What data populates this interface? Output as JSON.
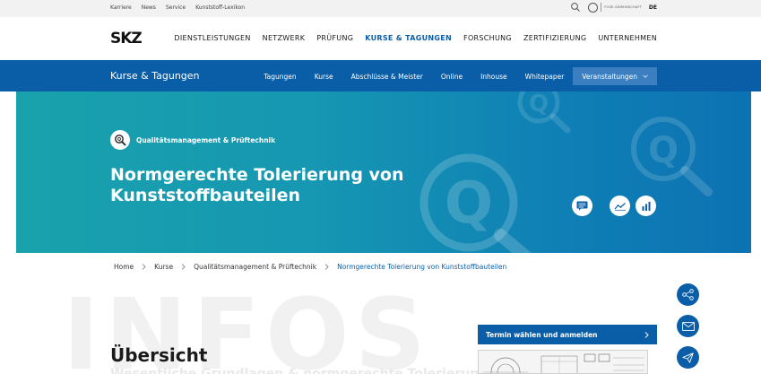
{
  "utility": {
    "links": [
      "Karriere",
      "News",
      "Service",
      "Kunststoff-Lexikon"
    ],
    "group_label": "FOSE-GEMEINSCHAFT",
    "language": "DE"
  },
  "header": {
    "brand": "SKZ",
    "nav": [
      {
        "label": "DIENSTLEISTUNGEN",
        "active": false
      },
      {
        "label": "NETZWERK",
        "active": false
      },
      {
        "label": "PRÜFUNG",
        "active": false
      },
      {
        "label": "KURSE & TAGUNGEN",
        "active": true
      },
      {
        "label": "FORSCHUNG",
        "active": false
      },
      {
        "label": "ZERTIFIZIERUNG",
        "active": false
      },
      {
        "label": "UNTERNEHMEN",
        "active": false
      }
    ]
  },
  "subnav": {
    "title": "Kurse & Tagungen",
    "items": [
      "Tagungen",
      "Kurse",
      "Abschlüsse & Meister",
      "Online",
      "Inhouse",
      "Whitepaper"
    ],
    "dropdown_label": "Veranstaltungen"
  },
  "hero": {
    "category": "Qualitätsmanagement & Prüftechnik",
    "title": "Normgerechte Tolerierung von Kunststoffbauteilen"
  },
  "breadcrumb": [
    "Home",
    "Kurse",
    "Qualitätsmanagement & Prüftechnik",
    "Normgerechte Tolerierung von Kunststoffbauteilen"
  ],
  "content": {
    "background_word": "INFOS",
    "section_title": "Übersicht",
    "subline": "Wesentliche Grundlagen & normgerechte Tolerierung"
  },
  "cta": {
    "label": "Termin wählen und anmelden"
  },
  "colors": {
    "brand_blue": "#0a5ea8",
    "hero_teal": "#19a2ac"
  }
}
